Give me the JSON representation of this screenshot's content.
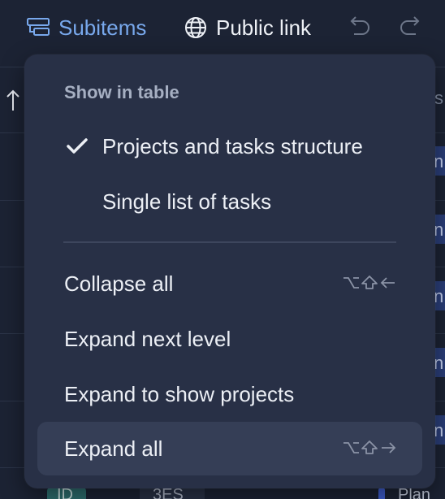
{
  "toolbar": {
    "subitems_label": "Subitems",
    "public_link_label": "Public link",
    "accent_color": "#78a8ec"
  },
  "background": {
    "partial_column_letter": "s",
    "chip_letter": "n",
    "bottom_row": {
      "id_badge": "ID",
      "code": "3ES",
      "status": "Plan"
    }
  },
  "menu": {
    "header": "Show in table",
    "view_options": [
      {
        "label": "Projects and tasks structure",
        "checked": true
      },
      {
        "label": "Single list of tasks",
        "checked": false
      }
    ],
    "actions": [
      {
        "label": "Collapse all",
        "shortcut": "⌥⇧←"
      },
      {
        "label": "Expand next level",
        "shortcut": ""
      },
      {
        "label": "Expand to show projects",
        "shortcut": ""
      },
      {
        "label": "Expand all",
        "shortcut": "⌥⇧→",
        "hovered": true
      }
    ]
  }
}
